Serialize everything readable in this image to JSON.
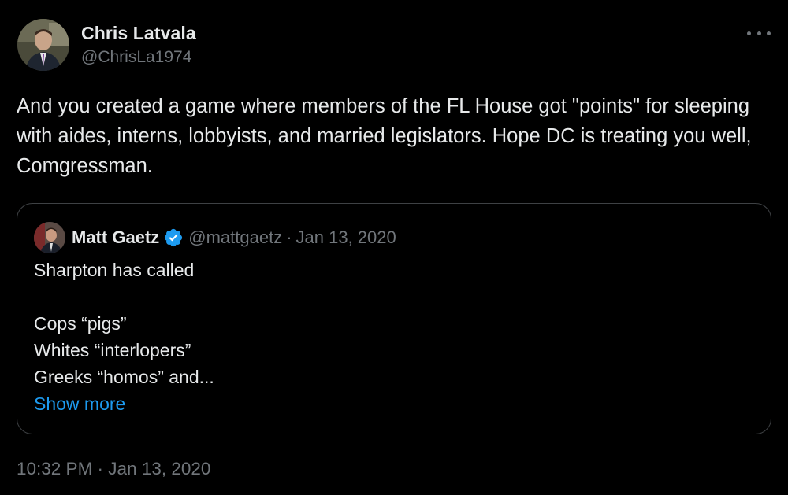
{
  "tweet": {
    "author": {
      "name": "Chris Latvala",
      "handle": "@ChrisLa1974"
    },
    "text": "And you created a game where members of the FL House got \"points\" for sleeping with aides, interns, lobbyists, and married legislators. Hope DC is treating you well, Comgressman.",
    "timestamp": "10:32 PM · Jan 13, 2020",
    "more_icon": "more-horizontal-icon"
  },
  "quoted_tweet": {
    "author": {
      "name": "Matt Gaetz",
      "handle": "@mattgaetz",
      "verified_icon": "verified-badge-icon"
    },
    "separator": "·",
    "date": "Jan 13, 2020",
    "lines": [
      "Sharpton has called",
      "",
      "Cops “pigs”",
      "Whites “interlopers”",
      "Greeks “homos” and..."
    ],
    "show_more": "Show more"
  },
  "colors": {
    "background": "#000000",
    "text": "#e7e9ea",
    "secondary": "#71767b",
    "accent": "#1d9bf0",
    "border": "#3e4144"
  }
}
